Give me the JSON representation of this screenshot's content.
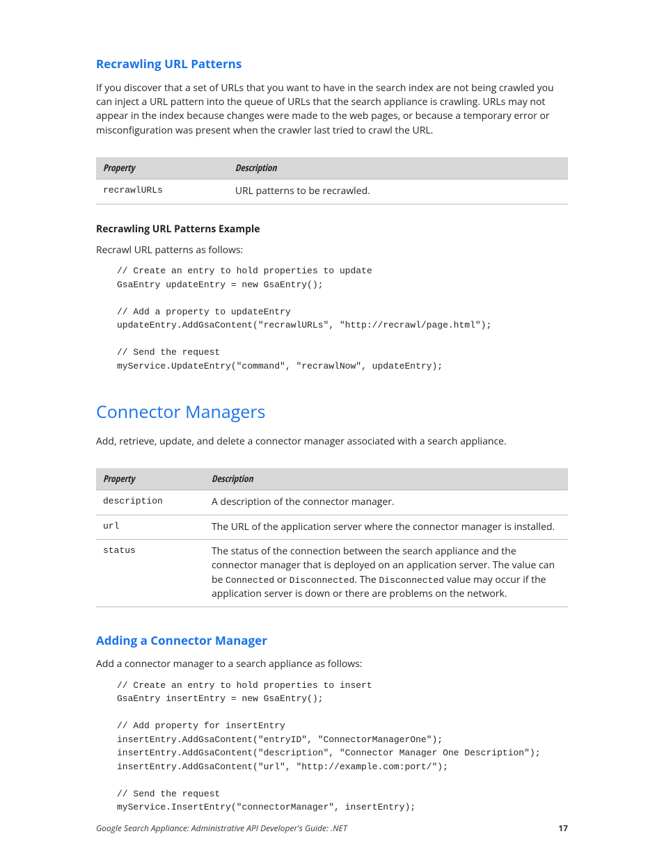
{
  "section1": {
    "title": "Recrawling URL Patterns",
    "para": "If you discover that a set of URLs that you want to have in the search index are not being crawled you can inject a URL pattern into the queue of URLs that the search appliance is crawling. URLs may not appear in the index because changes were made to the web pages, or because a temporary error or misconfiguration was present when the crawler last tried to crawl the URL.",
    "table": {
      "headProp": "Property",
      "headDesc": "Description",
      "rows": [
        {
          "prop": "recrawlURLs",
          "desc": "URL patterns to be recrawled."
        }
      ]
    },
    "exampleTitle": "Recrawling URL Patterns Example",
    "examplePara": "Recrawl URL patterns as follows:",
    "code": "// Create an entry to hold properties to update\nGsaEntry updateEntry = new GsaEntry();\n\n// Add a property to updateEntry\nupdateEntry.AddGsaContent(\"recrawlURLs\", \"http://recrawl/page.html\");\n\n// Send the request\nmyService.UpdateEntry(\"command\", \"recrawlNow\", updateEntry);"
  },
  "section2": {
    "title": "Connector Managers",
    "para": "Add, retrieve, update, and delete a connector manager associated with a search appliance.",
    "table": {
      "headProp": "Property",
      "headDesc": "Description",
      "rows": [
        {
          "prop": "description",
          "desc": "A description of the connector manager."
        },
        {
          "prop": "url",
          "desc": "The URL of the application server where the connector manager is installed."
        },
        {
          "prop": "status",
          "descPre": "The status of the connection between the search appliance and the connector manager that is deployed on an application server. The value can be ",
          "m1": "Connected",
          "mid1": " or ",
          "m2": "Disconnected",
          "mid2": ". The ",
          "m3": "Disconnected",
          "descPost": " value may occur if the application server is down or there are problems on the network."
        }
      ]
    },
    "sub": {
      "title": "Adding a Connector Manager",
      "para": "Add a connector manager to a search appliance as follows:",
      "code": "// Create an entry to hold properties to insert\nGsaEntry insertEntry = new GsaEntry();\n\n// Add property for insertEntry\ninsertEntry.AddGsaContent(\"entryID\", \"ConnectorManagerOne\");\ninsertEntry.AddGsaContent(\"description\", \"Connector Manager One Description\");\ninsertEntry.AddGsaContent(\"url\", \"http://example.com:port/\");\n\n// Send the request\nmyService.InsertEntry(\"connectorManager\", insertEntry);"
    }
  },
  "footer": {
    "text": "Google Search Appliance: Administrative API Developer's Guide: .NET",
    "page": "17"
  }
}
